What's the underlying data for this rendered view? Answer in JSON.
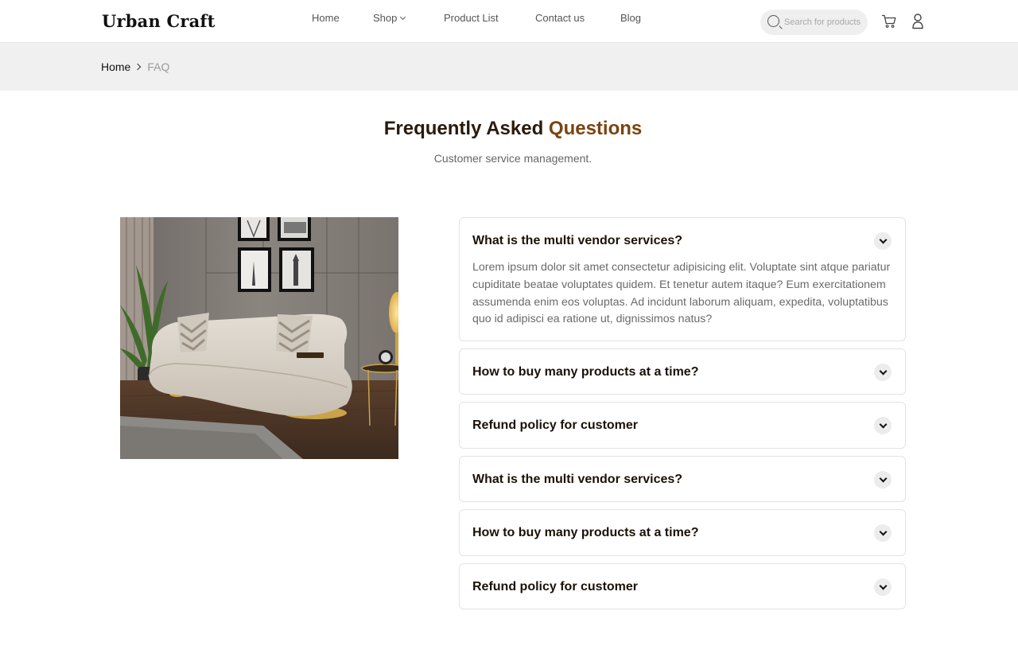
{
  "header": {
    "logo": "Urban Craft",
    "nav": [
      {
        "label": "Home"
      },
      {
        "label": "Shop"
      },
      {
        "label": "Product List"
      },
      {
        "label": "Contact us"
      },
      {
        "label": "Blog"
      }
    ],
    "search_placeholder": "Search for products"
  },
  "breadcrumb": {
    "home": "Home",
    "current": "FAQ"
  },
  "section": {
    "title_part1": "Frequently Asked",
    "title_part2": "Questions",
    "subtitle": "Customer service management."
  },
  "faqs": [
    {
      "question": "What is the multi vendor services?",
      "answer": "Lorem ipsum dolor sit amet consectetur adipisicing elit. Voluptate sint atque pariatur cupiditate beatae voluptates quidem. Et tenetur autem itaque? Eum exercitationem assumenda enim eos voluptas. Ad incidunt laborum aliquam, expedita, voluptatibus quo id adipisci ea ratione ut, dignissimos natus?",
      "expanded": true
    },
    {
      "question": "How to buy many products at a time?",
      "expanded": false
    },
    {
      "question": "Refund policy for customer",
      "expanded": false
    },
    {
      "question": "What is the multi vendor services?",
      "expanded": false
    },
    {
      "question": "How to buy many products at a time?",
      "expanded": false
    },
    {
      "question": "Refund policy for customer",
      "expanded": false
    }
  ],
  "colors": {
    "accent": "#7a4410",
    "title": "#2a1a0b",
    "breadcrumb_bg": "#f0f0f0"
  }
}
